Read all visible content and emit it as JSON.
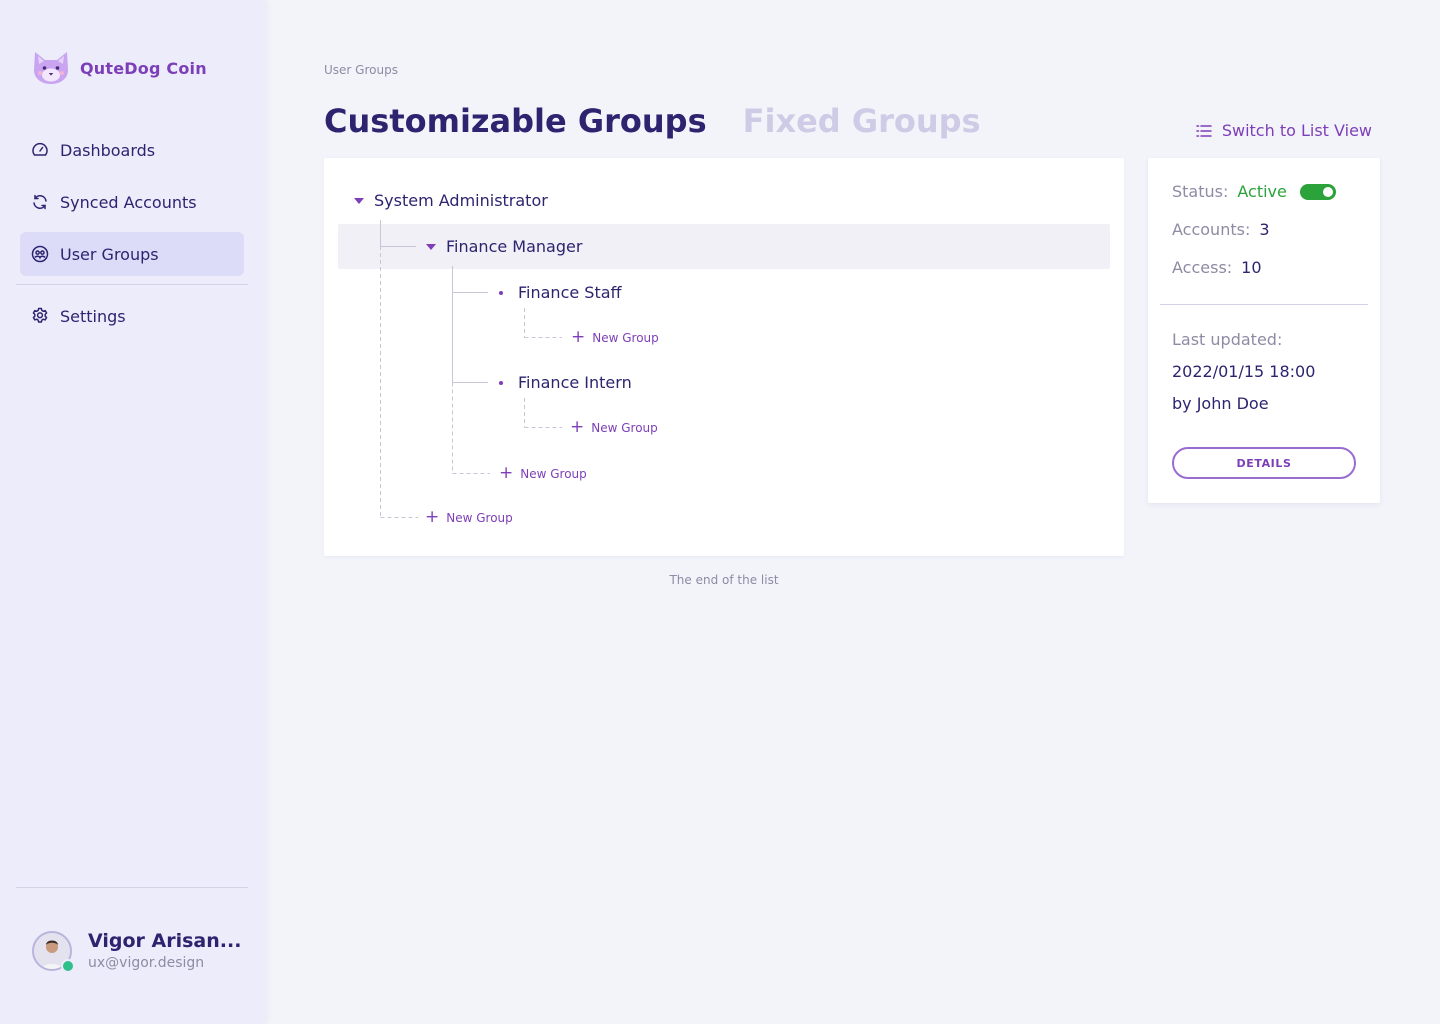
{
  "brand": {
    "name": "QuteDog Coin",
    "logo_icon": "dog-logo-icon",
    "accent": "#7c3fb8"
  },
  "sidebar": {
    "items": [
      {
        "label": "Dashboards",
        "icon": "gauge-icon"
      },
      {
        "label": "Synced Accounts",
        "icon": "sync-icon"
      },
      {
        "label": "User Groups",
        "icon": "user-groups-icon",
        "active": true
      },
      {
        "label": "Settings",
        "icon": "gear-icon"
      }
    ]
  },
  "user": {
    "name": "Vigor Arisan...",
    "email": "ux@vigor.design",
    "status_color": "#2fbf8a"
  },
  "breadcrumb": "User Groups",
  "tabs": [
    {
      "label": "Customizable Groups",
      "active": true
    },
    {
      "label": "Fixed Groups",
      "active": false
    }
  ],
  "switch_view": {
    "label": "Switch to List View",
    "icon": "list-icon"
  },
  "tree": {
    "root": {
      "label": "System Administrator"
    },
    "manager": {
      "label": "Finance Manager",
      "selected": true
    },
    "staff": {
      "label": "Finance Staff"
    },
    "intern": {
      "label": "Finance Intern"
    },
    "new_group_label": "New Group"
  },
  "end_of_list": "The end of the list",
  "details": {
    "status_key": "Status:",
    "status_value": "Active",
    "status_on": true,
    "accounts_key": "Accounts:",
    "accounts_value": "3",
    "access_key": "Access:",
    "access_value": "10",
    "updated_key": "Last updated:",
    "updated_date": "2022/01/15 18:00",
    "updated_by": "by John Doe",
    "button_label": "DETAILS"
  }
}
